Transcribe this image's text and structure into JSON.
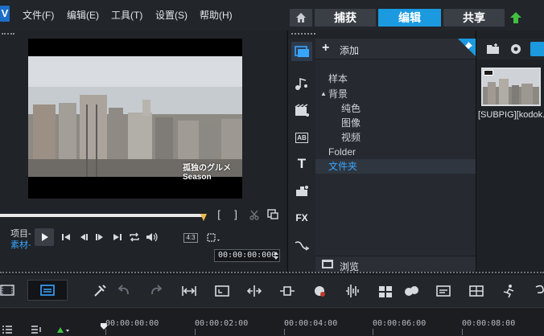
{
  "menubar": {
    "logo": "V",
    "items": [
      "文件(F)",
      "编辑(E)",
      "工具(T)",
      "设置(S)",
      "帮助(H)"
    ]
  },
  "tabs": {
    "home_icon": "home-icon",
    "items": [
      "捕获",
      "编辑",
      "共享"
    ],
    "active": "编辑",
    "upload_icon": "upload-arrow-icon"
  },
  "preview": {
    "caption": "孤独のグルメ Season",
    "mode_project": "项目-",
    "mode_clip": "素材-",
    "aspect": "4:3",
    "timecode": "00:00:00:000",
    "bracket_in": "[",
    "bracket_out": "]"
  },
  "library": {
    "add_label": "添加",
    "tree": [
      {
        "label": "样本",
        "depth": 1,
        "expander": ""
      },
      {
        "label": "背景",
        "depth": 1,
        "expander": "▲"
      },
      {
        "label": "纯色",
        "depth": 2,
        "expander": ""
      },
      {
        "label": "图像",
        "depth": 2,
        "expander": ""
      },
      {
        "label": "视频",
        "depth": 2,
        "expander": ""
      },
      {
        "label": "Folder",
        "depth": 1,
        "expander": ""
      },
      {
        "label": "文件夹",
        "depth": 1,
        "expander": "",
        "selected": true
      }
    ],
    "browse_label": "浏览",
    "categories": [
      "media-icon",
      "audio-icon",
      "transition-icon",
      "title-icon",
      "text-icon",
      "graphic-icon",
      "fx-icon",
      "path-icon"
    ],
    "fx_label": "FX",
    "title_label": "AB",
    "text_label": "T"
  },
  "media": {
    "item_name": "[SUBPIG][kodok..."
  },
  "timeline": {
    "ruler": [
      "00:00:00:00",
      "00:00:02:00",
      "00:00:04:00",
      "00:00:06:00",
      "00:00:08:00"
    ]
  },
  "colors": {
    "accent": "#1b9ae0",
    "highlight": "#38a6ff",
    "marker": "#e9b94a",
    "upload": "#43c042"
  }
}
